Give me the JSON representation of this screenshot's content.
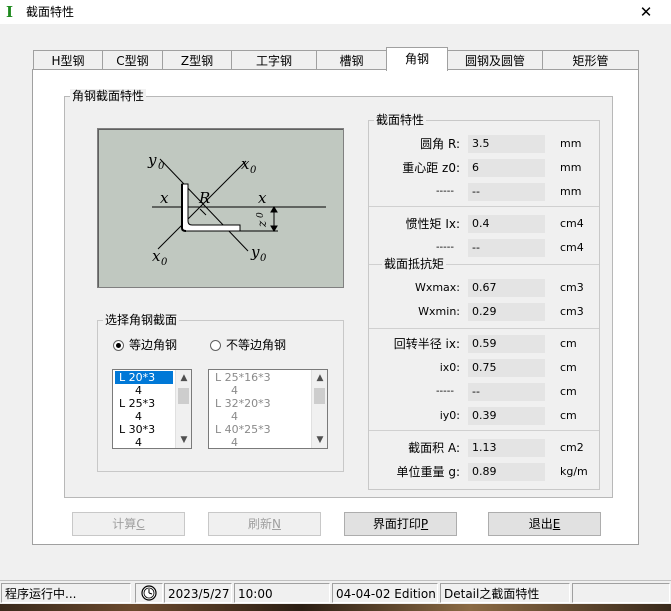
{
  "window": {
    "title": "截面特性",
    "app_icon": "I",
    "close_glyph": "✕"
  },
  "tabs": [
    {
      "label": "H型钢"
    },
    {
      "label": "C型钢"
    },
    {
      "label": "Z型钢"
    },
    {
      "label": "工字钢"
    },
    {
      "label": "槽钢"
    },
    {
      "label": "角钢",
      "active": true
    },
    {
      "label": "圆钢及圆管"
    },
    {
      "label": "矩形管"
    }
  ],
  "angle_section": {
    "title": "角钢截面特性",
    "diagram": {
      "labels": {
        "y0_top": "y",
        "y0_top_sub": "0",
        "x0_top": "x",
        "x0_top_sub": "0",
        "x_left": "x",
        "R": "R",
        "x_right": "x",
        "z0": "z",
        "z0_sub": "0",
        "x0_bottom": "x",
        "x0_bottom_sub": "0",
        "y0_bottom": "y",
        "y0_bottom_sub": "0"
      }
    },
    "select": {
      "title": "选择角钢截面",
      "radio_equal": "等边角钢",
      "radio_unequal": "不等边角钢",
      "equal_list": [
        "L 20*3",
        "4",
        "L 25*3",
        "4",
        "L 30*3",
        "4"
      ],
      "unequal_list": [
        "L 25*16*3",
        "4",
        "L 32*20*3",
        "4",
        "L 40*25*3",
        "4"
      ]
    }
  },
  "properties": {
    "title": "截面特性",
    "sub_title_resistance": "截面抵抗矩",
    "rows": {
      "radius": {
        "label": "圆角  R:",
        "value": "3.5",
        "unit": "mm"
      },
      "centroid": {
        "label": "重心距 z0:",
        "value": "6",
        "unit": "mm"
      },
      "blank1": {
        "label": "-----",
        "value": "--",
        "unit": "mm"
      },
      "ix": {
        "label": "惯性矩 Ix:",
        "value": "0.4",
        "unit": "cm4"
      },
      "blank2": {
        "label": "-----",
        "value": "--",
        "unit": "cm4"
      },
      "wxmax": {
        "label": "Wxmax:",
        "value": "0.67",
        "unit": "cm3"
      },
      "wxmin": {
        "label": "Wxmin:",
        "value": "0.29",
        "unit": "cm3"
      },
      "rix": {
        "label": "回转半径 ix:",
        "value": "0.59",
        "unit": "cm"
      },
      "ix0": {
        "label": "ix0:",
        "value": "0.75",
        "unit": "cm"
      },
      "blank3": {
        "label": "-----",
        "value": "--",
        "unit": "cm"
      },
      "iy0": {
        "label": "iy0:",
        "value": "0.39",
        "unit": "cm"
      },
      "area": {
        "label": "截面积 A:",
        "value": "1.13",
        "unit": "cm2"
      },
      "weight": {
        "label": "单位重量 g:",
        "value": "0.89",
        "unit": "kg/m"
      }
    }
  },
  "buttons": {
    "calc": {
      "label": "计算",
      "hotkey": "C"
    },
    "refresh": {
      "label": "刷新",
      "hotkey": "N"
    },
    "print": {
      "label": "界面打印",
      "hotkey": "P"
    },
    "exit": {
      "label": "退出",
      "hotkey": "E"
    }
  },
  "statusbar": {
    "status": "程序运行中...",
    "date": "2023/5/27",
    "time": "10:00",
    "edition": "04-04-02 Edition",
    "detail": "Detail之截面特性"
  },
  "colors": {
    "accent": "#0078d7",
    "panel": "#f0f0f0",
    "diagram_bg": "#c0c8c0",
    "app_icon": "#1f8a1f"
  }
}
